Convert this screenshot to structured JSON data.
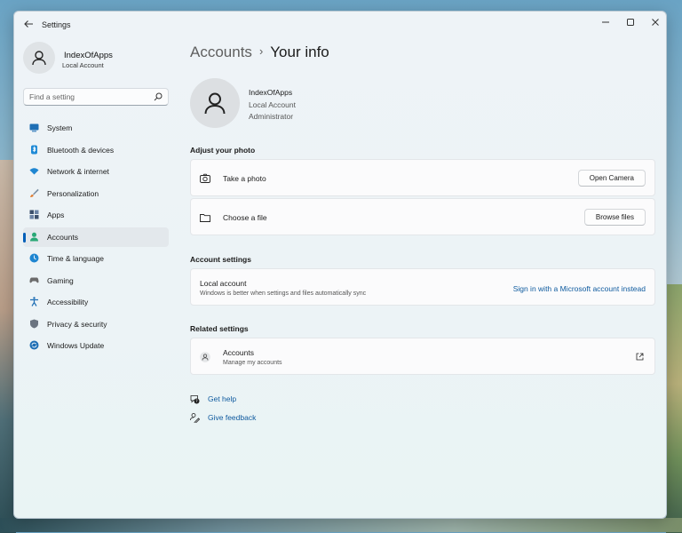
{
  "window": {
    "title": "Settings",
    "back_icon": "arrow-left-icon",
    "controls": [
      "minimize-icon",
      "maximize-icon",
      "close-icon"
    ]
  },
  "sidebar": {
    "profile": {
      "name": "IndexOfApps",
      "type": "Local Account"
    },
    "search": {
      "placeholder": "Find a setting",
      "value": ""
    },
    "items": [
      {
        "label": "System",
        "icon": "monitor-icon",
        "color": "#1f6fb5"
      },
      {
        "label": "Bluetooth & devices",
        "icon": "bluetooth-icon",
        "color": "#1f8ad6"
      },
      {
        "label": "Network & internet",
        "icon": "wifi-icon",
        "color": "#1f86d1"
      },
      {
        "label": "Personalization",
        "icon": "brush-icon",
        "color": "#e07a2e"
      },
      {
        "label": "Apps",
        "icon": "apps-icon",
        "color": "#3b4f6b"
      },
      {
        "label": "Accounts",
        "icon": "person-icon",
        "color": "#2aa876",
        "selected": true
      },
      {
        "label": "Time & language",
        "icon": "globe-clock-icon",
        "color": "#1f86d1"
      },
      {
        "label": "Gaming",
        "icon": "gamepad-icon",
        "color": "#6b6b6b"
      },
      {
        "label": "Accessibility",
        "icon": "accessibility-icon",
        "color": "#1f6fb5"
      },
      {
        "label": "Privacy & security",
        "icon": "shield-icon",
        "color": "#6b7480"
      },
      {
        "label": "Windows Update",
        "icon": "update-icon",
        "color": "#1f6fb5"
      }
    ]
  },
  "main": {
    "breadcrumb": {
      "parent": "Accounts",
      "current": "Your info"
    },
    "user": {
      "name": "IndexOfApps",
      "type": "Local Account",
      "role": "Administrator"
    },
    "photo_section": {
      "title": "Adjust your photo",
      "rows": [
        {
          "label": "Take a photo",
          "icon": "camera-icon",
          "button": "Open Camera"
        },
        {
          "label": "Choose a file",
          "icon": "folder-icon",
          "button": "Browse files"
        }
      ]
    },
    "account_section": {
      "title": "Account settings",
      "label": "Local account",
      "sub": "Windows is better when settings and files automatically sync",
      "link": "Sign in with a Microsoft account instead"
    },
    "related_section": {
      "title": "Related settings",
      "label": "Accounts",
      "sub": "Manage my accounts",
      "icon": "person-icon",
      "action_icon": "open-external-icon"
    },
    "help": [
      {
        "label": "Get help",
        "icon": "help-icon"
      },
      {
        "label": "Give feedback",
        "icon": "feedback-icon"
      }
    ]
  },
  "colors": {
    "accent": "#005fb8",
    "link": "#0e5a9e"
  }
}
